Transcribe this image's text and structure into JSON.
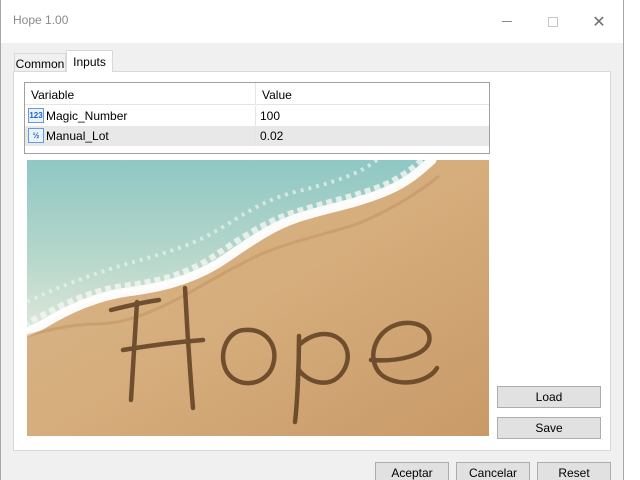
{
  "window": {
    "title": "Hope 1.00",
    "close_glyph": "✕"
  },
  "tabs": [
    {
      "label": "Common",
      "active": false
    },
    {
      "label": "Inputs",
      "active": true
    }
  ],
  "table": {
    "headers": {
      "variable": "Variable",
      "value": "Value"
    },
    "rows": [
      {
        "icon": "integer-icon",
        "icon_text": "123",
        "variable": "Magic_Number",
        "value": "100"
      },
      {
        "icon": "fraction-icon",
        "icon_text": "½",
        "variable": "Manual_Lot",
        "value": "0.02"
      }
    ]
  },
  "picture": {
    "word": "Hope"
  },
  "side_buttons": {
    "load": "Load",
    "save": "Save"
  },
  "footer_buttons": {
    "ok": "Aceptar",
    "cancel": "Cancelar",
    "reset": "Reset"
  }
}
